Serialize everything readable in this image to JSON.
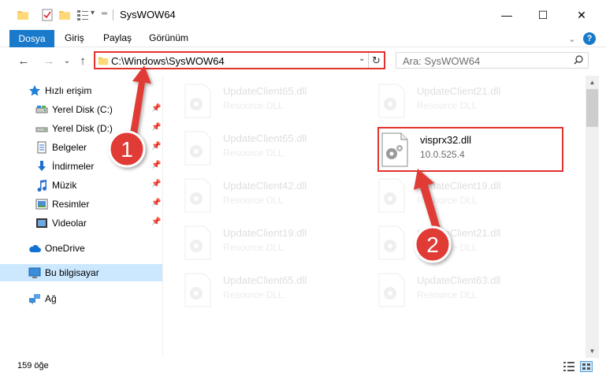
{
  "window": {
    "title": "SysWOW64",
    "minimize_glyph": "—",
    "maximize_glyph": "☐",
    "close_glyph": "✕",
    "quick_access_dropdown": "▾"
  },
  "ribbon": {
    "tabs": [
      "Dosya",
      "Giriş",
      "Paylaş",
      "Görünüm"
    ],
    "expand_glyph": "⌄",
    "help_glyph": "?"
  },
  "nav": {
    "back_glyph": "←",
    "forward_glyph": "→",
    "recent_glyph": "⌄",
    "up_glyph": "↑",
    "address": "C:\\Windows\\SysWOW64",
    "address_dropdown": "⌄",
    "refresh_glyph": "↻",
    "search_placeholder": "Ara: SysWOW64"
  },
  "sidebar": {
    "items": [
      {
        "label": "Hızlı erişim",
        "icon": "star-icon",
        "pinned": false
      },
      {
        "label": "Yerel Disk (C:)",
        "icon": "drive-icon",
        "pinned": true
      },
      {
        "label": "Yerel Disk (D:)",
        "icon": "drive-icon",
        "pinned": true
      },
      {
        "label": "Belgeler",
        "icon": "documents-icon",
        "pinned": true
      },
      {
        "label": "İndirmeler",
        "icon": "downloads-icon",
        "pinned": true
      },
      {
        "label": "Müzik",
        "icon": "music-icon",
        "pinned": true
      },
      {
        "label": "Resimler",
        "icon": "pictures-icon",
        "pinned": true
      },
      {
        "label": "Videolar",
        "icon": "videos-icon",
        "pinned": true
      },
      {
        "label": "OneDrive",
        "icon": "cloud-icon",
        "pinned": false
      },
      {
        "label": "Bu bilgisayar",
        "icon": "computer-icon",
        "pinned": false
      },
      {
        "label": "Ağ",
        "icon": "network-icon",
        "pinned": false
      }
    ],
    "pin_glyph": "📌"
  },
  "files": [
    {
      "name": "UpdateClient65.dll",
      "sub": "Resource DLL",
      "ghost": true
    },
    {
      "name": "UpdateClient21.dll",
      "sub": "Resource DLL",
      "ghost": true
    },
    {
      "name": "UpdateClient65.dll",
      "sub": "Resource DLL",
      "ghost": true
    },
    {
      "name": "visprx32.dll",
      "sub": "10.0.525.4",
      "ghost": false
    },
    {
      "name": "UpdateClient42.dll",
      "sub": "Resource DLL",
      "ghost": true
    },
    {
      "name": "UpdateClient19.dll",
      "sub": "Resource DLL",
      "ghost": true
    },
    {
      "name": "UpdateClient19.dll",
      "sub": "Resource DLL",
      "ghost": true
    },
    {
      "name": "UpdateClient21.dll",
      "sub": "Resource DLL",
      "ghost": true
    },
    {
      "name": "UpdateClient65.dll",
      "sub": "Resource DLL",
      "ghost": true
    },
    {
      "name": "UpdateClient63.dll",
      "sub": "Resource DLL",
      "ghost": true
    }
  ],
  "status": {
    "count": "159 öğe"
  },
  "annotations": {
    "step1": "1",
    "step2": "2",
    "accent_color": "#e2322d"
  },
  "colors": {
    "file_tab": "#1979ca",
    "selection": "#cce8ff"
  }
}
